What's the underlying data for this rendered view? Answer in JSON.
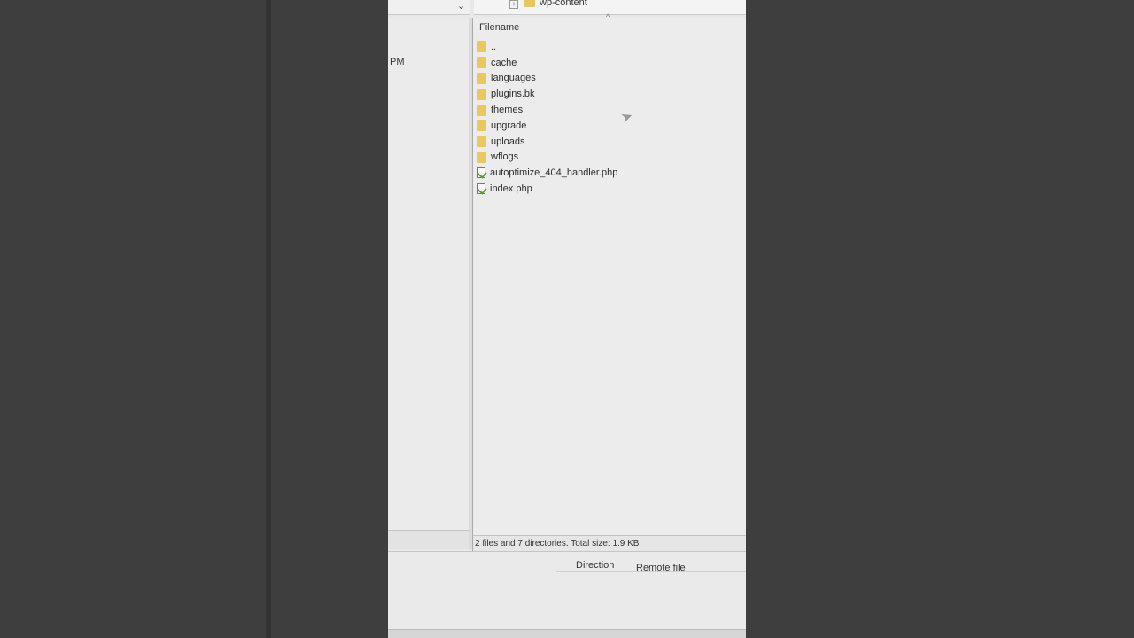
{
  "tree": {
    "expander": "+",
    "node_label": "wp-content"
  },
  "left_pane": {
    "time_fragment": "PM"
  },
  "file_list": {
    "column_filename": "Filename",
    "sort_indicator": "^",
    "rows": [
      {
        "name": "..",
        "type": "folder"
      },
      {
        "name": "cache",
        "type": "folder"
      },
      {
        "name": "languages",
        "type": "folder"
      },
      {
        "name": "plugins.bk",
        "type": "folder"
      },
      {
        "name": "themes",
        "type": "folder"
      },
      {
        "name": "upgrade",
        "type": "folder"
      },
      {
        "name": "uploads",
        "type": "folder"
      },
      {
        "name": "wflogs",
        "type": "folder"
      },
      {
        "name": "autoptimize_404_handler.php",
        "type": "file"
      },
      {
        "name": "index.php",
        "type": "file"
      }
    ]
  },
  "status": {
    "summary": "2 files and 7 directories. Total size: 1.9 KB"
  },
  "queue": {
    "col_direction": "Direction",
    "col_remote_file": "Remote file"
  },
  "colors": {
    "folder": "#e9c860",
    "file_check": "#5aa02c"
  }
}
